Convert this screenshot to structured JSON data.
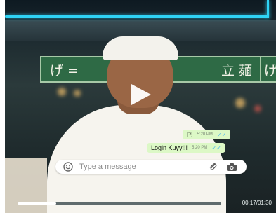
{
  "video": {
    "elapsed": "00:17",
    "duration": "01:30",
    "progress_fraction": 0.19,
    "timecode": "00:17/01:30"
  },
  "signs": {
    "left_text": "げ =",
    "right_text": "立 麺",
    "edge_text": "げ"
  },
  "chat": {
    "messages": [
      {
        "text": "P!",
        "time": "5:20 PM"
      },
      {
        "text": "Login Kuyy!!!",
        "time": "5:20 PM"
      }
    ],
    "input_placeholder": "Type a message",
    "bubble_color": "#dcf8c6",
    "tick_color": "#4fb6ec"
  },
  "icons": {
    "play": "play-icon",
    "emoji": "emoji-icon",
    "attach": "paperclip-icon",
    "camera": "camera-icon",
    "read_receipt": "double-check-icon"
  },
  "colors": {
    "neon_accent": "#2fd3f5"
  }
}
